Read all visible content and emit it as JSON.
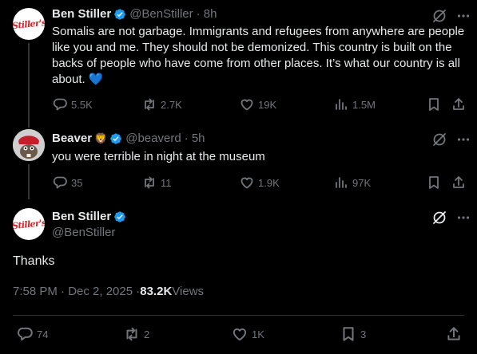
{
  "tweets": [
    {
      "name": "Ben Stiller",
      "handle": "@BenStiller",
      "time": "· 8h",
      "avatar_text": "Stiller's",
      "text": "Somalis are not garbage. Immigrants and refugees from anywhere are people like you and me. They should not be demonized. This country is built on the backs of people who have come from other places. It’s what our country is all about. 💙",
      "replies": "5.5K",
      "reposts": "2.7K",
      "likes": "19K",
      "views": "1.5M"
    },
    {
      "name": "Beaver",
      "badge_emoji": "🦁",
      "handle": "@beaverd",
      "time": "· 5h",
      "text": "you were terrible in night at the museum",
      "replies": "35",
      "reposts": "11",
      "likes": "1.9K",
      "views": "97K"
    }
  ],
  "main": {
    "name": "Ben Stiller",
    "handle": "@BenStiller",
    "avatar_text": "Stiller's",
    "text": "Thanks",
    "timestamp": "7:58 PM · Dec 2, 2025 · ",
    "views_count": "83.2K",
    "views_label": " Views",
    "replies": "74",
    "reposts": "2",
    "likes": "1K",
    "bookmarks": "3"
  },
  "colors": {
    "background": "#000000",
    "text": "#e7e9ea",
    "muted": "#71767b",
    "verified": "#1d9bf0",
    "divider": "#2f3336"
  }
}
